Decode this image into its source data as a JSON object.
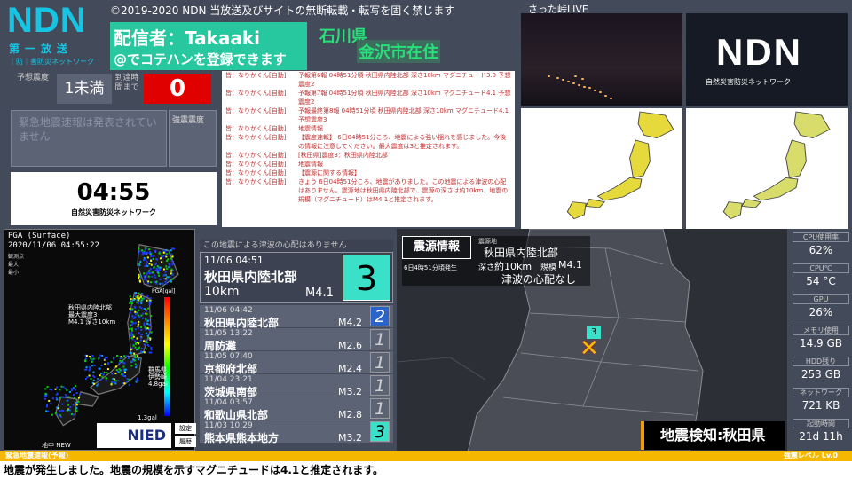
{
  "logo": {
    "name": "NDN",
    "sub1": "第一放送",
    "sub2": "｜防｜害防災ネットワーク"
  },
  "copyright": "©2019-2020 NDN 当放送及びサイトの無断転載・転写を固く禁じます",
  "broadcaster": {
    "name": "配信者：Takaaki",
    "note": "@でコテハンを登録できます"
  },
  "location": {
    "pref": "石川県",
    "city": "金沢市在住"
  },
  "estimate": {
    "label": "予想震度",
    "value": "1未満"
  },
  "arrival": {
    "label": "到達時間まで",
    "value": "0"
  },
  "eew_status": "緊急地震速報は発表されていません",
  "intensity_label": "強震震度",
  "clock": {
    "time": "04:55",
    "subtitle": "自然災害防災ネットワーク"
  },
  "chat": [
    {
      "user": "皆：なりかくん[自動]",
      "body": "予報第6報 04時51分頃 秋田県内陸北部 深さ10km マグニチュード3.9 予想震度2"
    },
    {
      "user": "皆：なりかくん[自動]",
      "body": "予報第7報 04時51分頃 秋田県内陸北部 深さ10km マグニチュード4.1 予想震度2"
    },
    {
      "user": "皆：なりかくん[自動]",
      "body": "予報最終第8報 04時51分頃 秋田県内陸北部 深さ10km マグニチュード4.1 予想震度3"
    },
    {
      "user": "皆：なりかくん[自動]",
      "body": "地震情報"
    },
    {
      "user": "皆：なりかくん[自動]",
      "body": "【震度速報】 6日04時51分ころ、地震による強い揺れを感じました。今後の情報に注意してください。最大震度は3と推定されます。"
    },
    {
      "user": "皆：なりかくん[自動]",
      "body": "[秋田県]震度3：秋田県内陸北部"
    },
    {
      "user": "皆：なりかくん[自動]",
      "body": "地震情報"
    },
    {
      "user": "皆：なりかくん[自動]",
      "body": "【震源に関する情報】"
    },
    {
      "user": "皆：なりかくん[自動]",
      "body": "きょう 6日04時51分ころ、地震がありました。この地震による津波の心配はありません。震源地は秋田県内陸北部で、震源の深さは約10km、地震の規模（マグニチュード）はM4.1と推定されます。"
    }
  ],
  "camera_label": "さった峠LIVE",
  "ndn_brand": {
    "name": "NDN",
    "sub": "自然災害防災ネットワーク"
  },
  "pga": {
    "title": "PGA (Surface)",
    "time": "2020/11/06 04:55:22",
    "legend": [
      "観測点",
      "最大",
      "最小"
    ],
    "unit": "PGA[gal]",
    "ann1": "秋田県内陸北部",
    "ann2": "最大震度3",
    "ann3": "M4.1 深さ10km",
    "ann4": "群馬県",
    "ann5": "伊勢崎",
    "ann6": "4.8gal",
    "val": "1.3gal",
    "footer": "地中 NEW",
    "org": "NIED",
    "btn1": "設定",
    "btn2": "履歴"
  },
  "tsunami_note": "この地震による津波の心配はありません",
  "latest": {
    "time": "11/06 04:51",
    "place": "秋田県内陸北部",
    "depth": "10km",
    "mag": "M4.1",
    "intensity": "3"
  },
  "history": [
    {
      "time": "11/06 04:42",
      "place": "秋田県内陸北部",
      "mag": "M4.2",
      "intensity": "2",
      "color": "#2a64c8",
      "ic": "#fff"
    },
    {
      "time": "11/05 13:22",
      "place": "周防灘",
      "mag": "M2.6",
      "intensity": "1",
      "color": "#5c6375",
      "ic": "#cfcfcf"
    },
    {
      "time": "11/05 07:40",
      "place": "京都府北部",
      "mag": "M2.4",
      "intensity": "1",
      "color": "#5c6375",
      "ic": "#cfcfcf"
    },
    {
      "time": "11/04 23:21",
      "place": "茨城県南部",
      "mag": "M3.2",
      "intensity": "1",
      "color": "#5c6375",
      "ic": "#cfcfcf"
    },
    {
      "time": "11/04 03:57",
      "place": "和歌山県北部",
      "mag": "M2.8",
      "intensity": "1",
      "color": "#5c6375",
      "ic": "#cfcfcf"
    },
    {
      "time": "11/03 10:29",
      "place": "熊本県熊本地方",
      "mag": "M3.2",
      "intensity": "3",
      "color": "#3ae0c8",
      "ic": "#000"
    }
  ],
  "epicenter": {
    "title": "震源情報",
    "area_label": "震源地",
    "area": "秋田県内陸北部",
    "time": "6日4時51分頃発生",
    "depth_label": "深さ",
    "depth": "約10km",
    "mag_label": "規模",
    "mag": "M4.1",
    "tsunami": "津波の心配なし",
    "marker": "3"
  },
  "detection": "地震検知:秋田県",
  "stats": [
    {
      "label": "CPU使用率",
      "value": "62%"
    },
    {
      "label": "CPU℃",
      "value": "54 °C"
    },
    {
      "label": "GPU",
      "value": "26%"
    },
    {
      "label": "メモリ使用",
      "value": "14.9 GB"
    },
    {
      "label": "HDD残り",
      "value": "253 GB"
    },
    {
      "label": "ネットワーク",
      "value": "721 KB"
    },
    {
      "label": "起動時間",
      "value": "21d 11h"
    }
  ],
  "bottom_bar": {
    "left": "緊急地震速報(予報)",
    "right": "強震レベル Lv.0"
  },
  "ticker": "地震が発生しました。地震の規模を示すマグニチュードは4.1と推定されます。"
}
